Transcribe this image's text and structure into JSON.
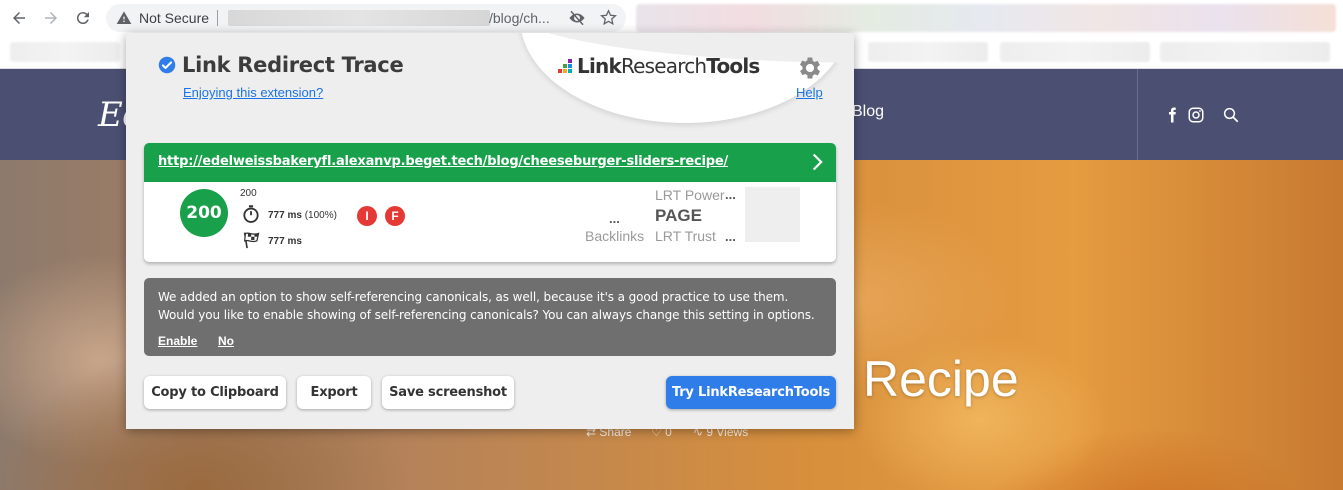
{
  "browser": {
    "security_label": "Not Secure",
    "url_visible": "/blog/ch..."
  },
  "site": {
    "logo_text": "Ed",
    "nav_blog": "Blog",
    "hero_title": "Recipe",
    "share_label": "Share",
    "likes": "0",
    "views": "9 Views"
  },
  "popup": {
    "title": "Link Redirect Trace",
    "enjoy_link": "Enjoying this extension?",
    "brand_bold": "Link",
    "brand_light": "Research",
    "brand_bold2": "Tools",
    "help_link": "Help",
    "result": {
      "url": "http://edelweissbakeryfl.alexanvp.beget.tech/blog/cheeseburger-sliders-recipe/",
      "status_code": "200",
      "status_code_small": "200",
      "time_ms": "777 ms",
      "time_pct": "(100%)",
      "final_time_ms": "777 ms",
      "badge_i": "I",
      "badge_f": "F",
      "backlinks_value": "...",
      "backlinks_label": "Backlinks",
      "lrt_power_label": "LRT Power",
      "lrt_power_value": "...",
      "page_label": "PAGE",
      "lrt_trust_label": "LRT Trust",
      "lrt_trust_value": "..."
    },
    "notice": {
      "line1": "We added an option to show self-referencing canonicals, as well, because it's a good practice to use them.",
      "line2": "Would you like to enable showing of self-referencing canonicals? You can always change this setting in options.",
      "enable": "Enable",
      "no": "No"
    },
    "buttons": {
      "copy": "Copy to Clipboard",
      "export": "Export",
      "screenshot": "Save screenshot",
      "try": "Try LinkResearchTools"
    }
  },
  "colors": {
    "green": "#19a04a",
    "accent_blue": "#2f7de8",
    "badge_red": "#e53935",
    "site_header": "#4b4f72"
  }
}
